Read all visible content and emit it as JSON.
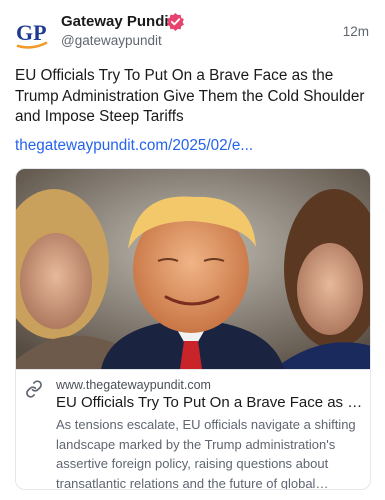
{
  "post": {
    "account_name": "Gateway Pundit",
    "handle": "@gatewaypundit",
    "timestamp": "12m",
    "text": "EU Officials Try To Put On a Brave Face as the Trump Administration Give Them the Cold Shoulder and Impose Steep Tariffs",
    "link": "thegatewaypundit.com/2025/02/e..."
  },
  "avatar": {
    "logo_text": "GP",
    "icon": "gateway-pundit-logo"
  },
  "verified_badge": {
    "icon": "verified-badge-icon",
    "color": "#e8436e"
  },
  "card": {
    "image_icon": "article-photo",
    "domain": "www.thegatewaypundit.com",
    "title": "EU Officials Try To Put On a Brave Face as the ...",
    "description": "As tensions escalate, EU officials navigate a shifting landscape marked by the Trump administration's assertive foreign policy, raising questions about transatlantic relations and the future of global diplom...",
    "link_icon": "link-icon"
  },
  "colors": {
    "link": "#2563eb",
    "secondary_text": "#5f6670",
    "logo_blue": "#1f3a93",
    "logo_orange": "#f39a2b"
  }
}
